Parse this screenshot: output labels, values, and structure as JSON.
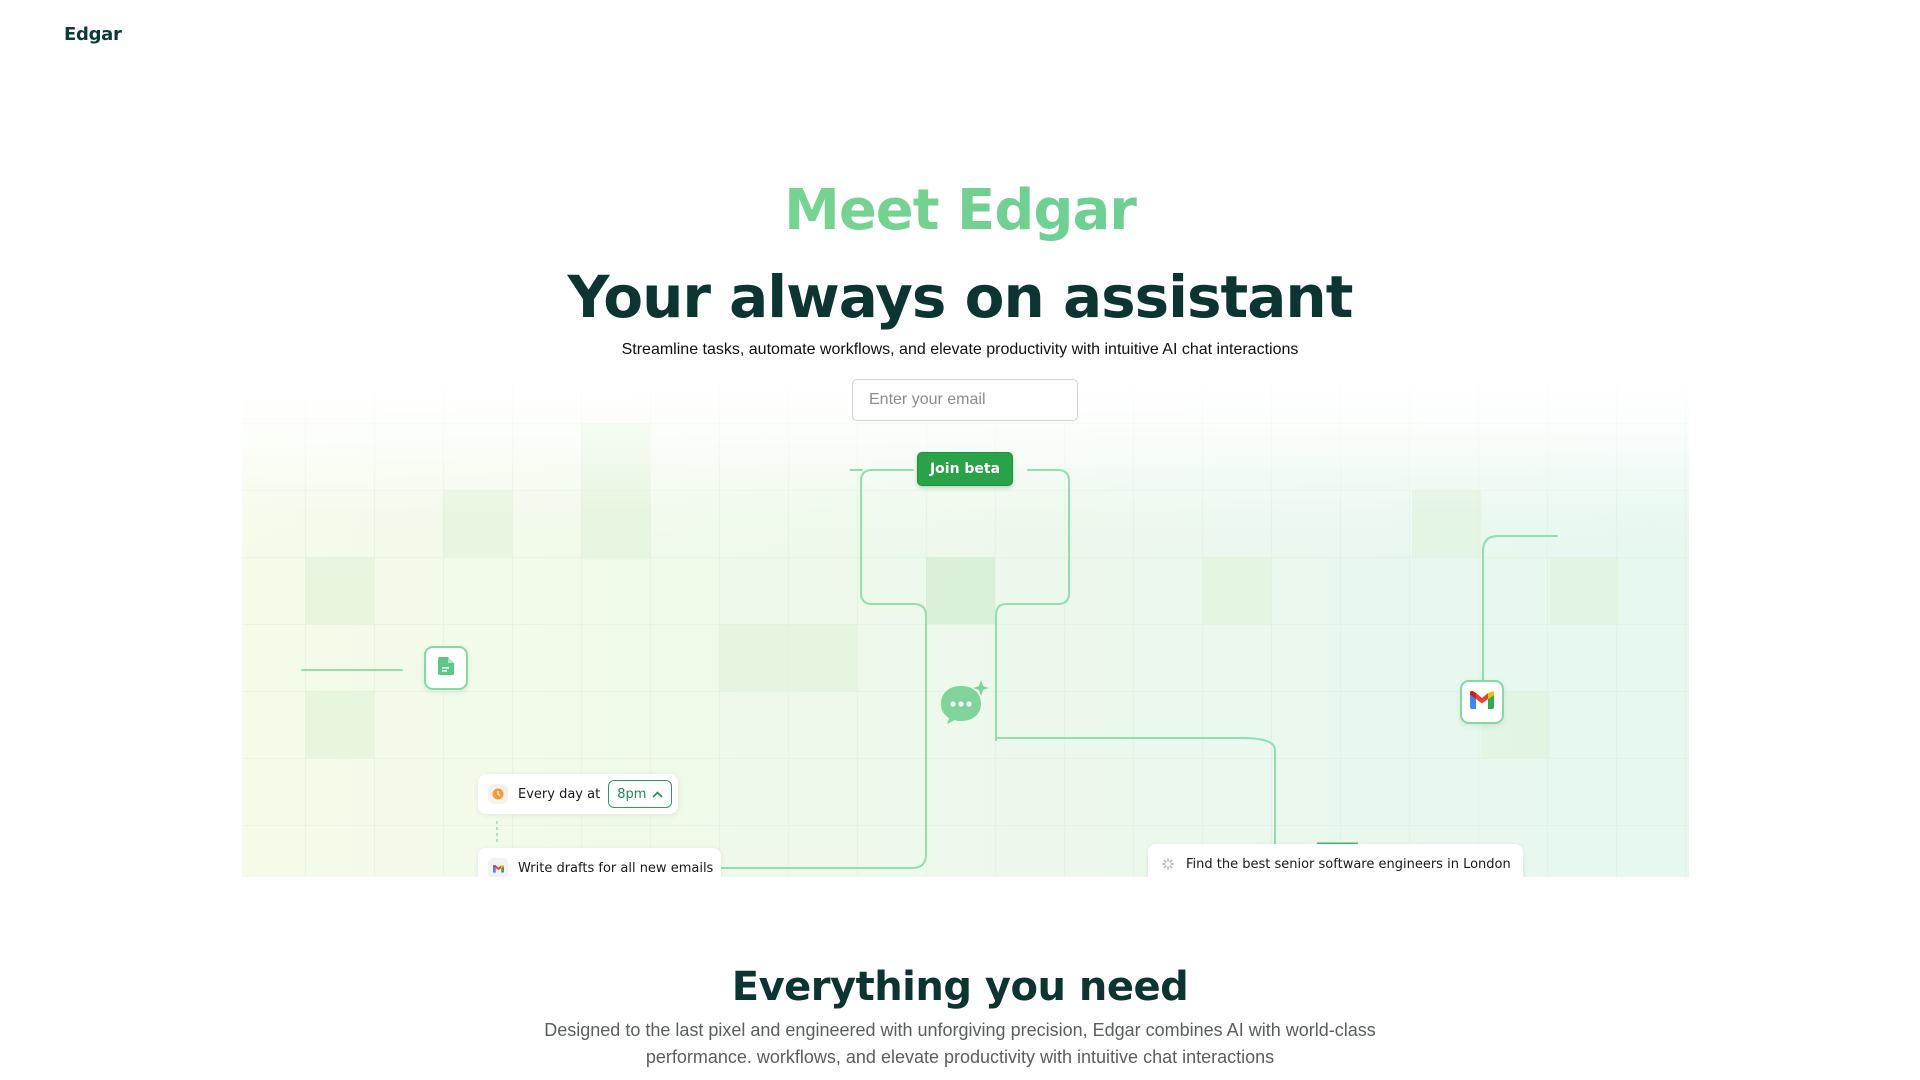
{
  "brand": "Edgar",
  "hero": {
    "eyebrow": "Meet Edgar",
    "title": "Your always on assistant",
    "subtitle": "Streamline tasks, automate workflows, and elevate productivity with intuitive AI chat interactions",
    "email_placeholder": "Enter your email",
    "cta_label": "Join beta"
  },
  "illustration": {
    "schedule_card": {
      "label": "Every day at",
      "time": "8pm"
    },
    "email_task": "Write drafts for all new emails",
    "search_task": "Find the best senior software engineers in London",
    "icons": [
      "document-icon",
      "chat-sparkle-icon",
      "gmail-icon"
    ]
  },
  "features": {
    "title": "Everything you need",
    "description": "Designed to the last pixel and engineered with unforgiving precision, Edgar combines AI with world-class performance. workflows, and elevate productivity with intuitive chat interactions"
  },
  "colors": {
    "accent": "#2aa24a",
    "brand_dark": "#0c3431",
    "gradient_start": "#8fdc8a",
    "gradient_end": "#55c69a"
  }
}
